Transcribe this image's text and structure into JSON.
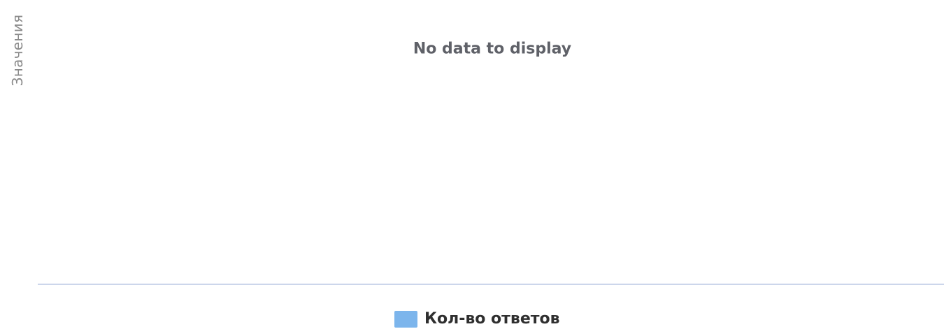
{
  "chart_data": {
    "type": "bar",
    "title": "",
    "xlabel": "",
    "ylabel": "Значения",
    "no_data_message": "No data to display",
    "series": [
      {
        "name": "Кол-во ответов",
        "color": "#7cb5ec",
        "values": []
      }
    ],
    "legend_position": "bottom-center",
    "grid": false
  }
}
